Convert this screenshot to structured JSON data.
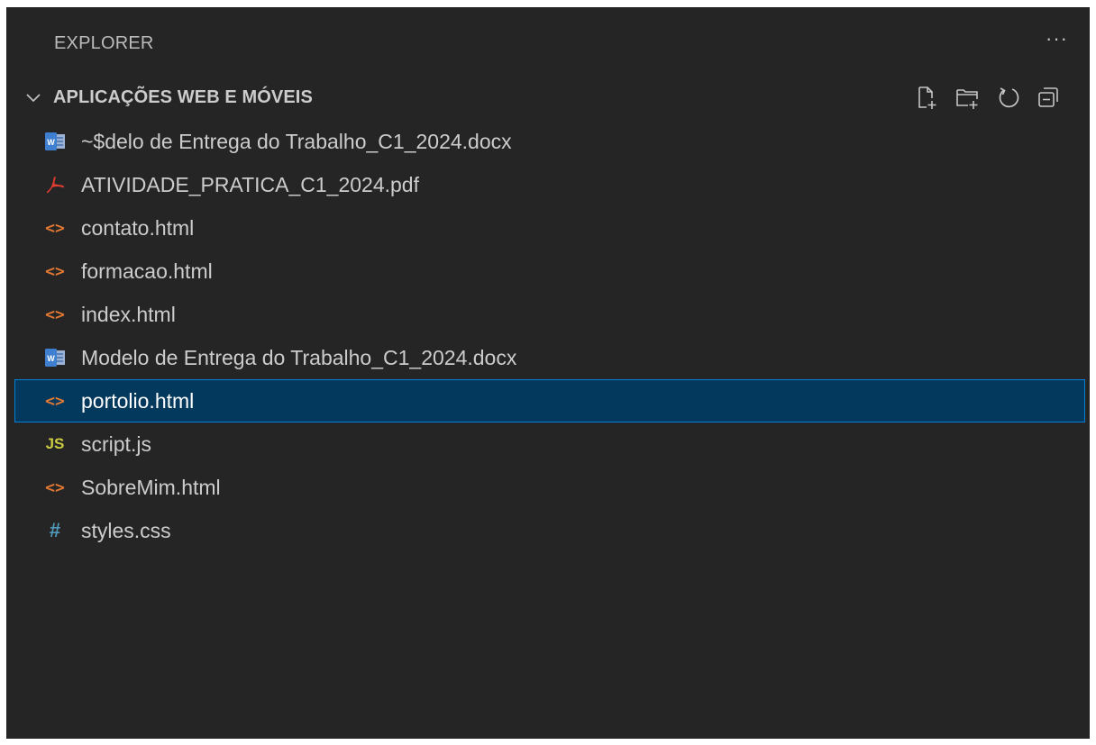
{
  "panel": {
    "title": "EXPLORER",
    "more_label": "···"
  },
  "section": {
    "title": "APLICAÇÕES WEB E MÓVEIS",
    "expanded": true,
    "actions": [
      "new-file-icon",
      "new-folder-icon",
      "refresh-icon",
      "collapse-all-icon"
    ]
  },
  "files": [
    {
      "name": "~$delo de Entrega do Trabalho_C1_2024.docx",
      "icon": "word-icon"
    },
    {
      "name": "ATIVIDADE_PRATICA_C1_2024.pdf",
      "icon": "pdf-icon"
    },
    {
      "name": "contato.html",
      "icon": "html-icon"
    },
    {
      "name": "formacao.html",
      "icon": "html-icon"
    },
    {
      "name": "index.html",
      "icon": "html-icon"
    },
    {
      "name": "Modelo de Entrega do Trabalho_C1_2024.docx",
      "icon": "word-icon"
    },
    {
      "name": "portolio.html",
      "icon": "html-icon",
      "selected": true
    },
    {
      "name": "script.js",
      "icon": "js-icon"
    },
    {
      "name": "SobreMim.html",
      "icon": "html-icon"
    },
    {
      "name": "styles.css",
      "icon": "css-icon"
    }
  ],
  "icon_glyphs": {
    "html": "<>",
    "js": "JS",
    "css": "#"
  },
  "colors": {
    "background": "#252526",
    "text": "#cccccc",
    "selection_bg": "#04395e",
    "selection_border": "#007fd4",
    "html_icon": "#e37933",
    "js_icon": "#cbcb41",
    "css_icon": "#519aba",
    "pdf_icon": "#e03c31",
    "word_icon": "#3f7fcf"
  }
}
